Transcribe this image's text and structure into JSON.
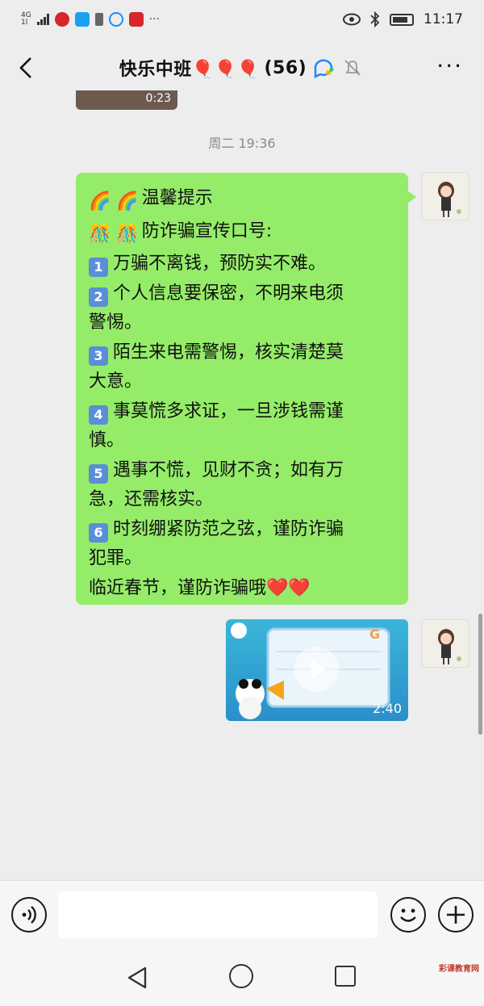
{
  "status_bar": {
    "network": "4G",
    "network_sub": "1l",
    "time": "11:17",
    "more_glyph": "···"
  },
  "header": {
    "back_icon": "chevron-left-icon",
    "title": "快乐中班🎈🎈🎈",
    "member_count": "(56)",
    "more_glyph": "···"
  },
  "previous_video": {
    "duration": "0:23"
  },
  "timestamp": "周二 19:36",
  "message": {
    "lines": [
      {
        "prefix": "🌈 🌈 ",
        "text": "温馨提示"
      },
      {
        "prefix": "🎊 🎊 ",
        "text": "防诈骗宣传口号:"
      },
      {
        "num": "1",
        "text": "万骗不离钱，预防实不难。"
      },
      {
        "num": "2",
        "text": "个人信息要保密，不明来电须"
      },
      {
        "text": "警惕。"
      },
      {
        "num": "3",
        "text": "陌生来电需警惕，核实清楚莫"
      },
      {
        "text": "大意。"
      },
      {
        "num": "4",
        "text": "事莫慌多求证，一旦涉钱需谨"
      },
      {
        "text": "慎。"
      },
      {
        "num": "5",
        "text": "遇事不慌，见财不贪；如有万"
      },
      {
        "text": "急，还需核实。"
      },
      {
        "num": "6",
        "text": "时刻绷紧防范之弦，谨防诈骗"
      },
      {
        "text": "犯罪。"
      },
      {
        "text": "临近春节，谨防诈骗哦❤️❤️"
      }
    ]
  },
  "video_message": {
    "duration": "2:40"
  },
  "input": {
    "placeholder": "",
    "value": ""
  },
  "watermark": "彩课教育网",
  "colors": {
    "bubble": "#95ec69",
    "background": "#ededed",
    "number_badge": "#5a8fd8"
  }
}
